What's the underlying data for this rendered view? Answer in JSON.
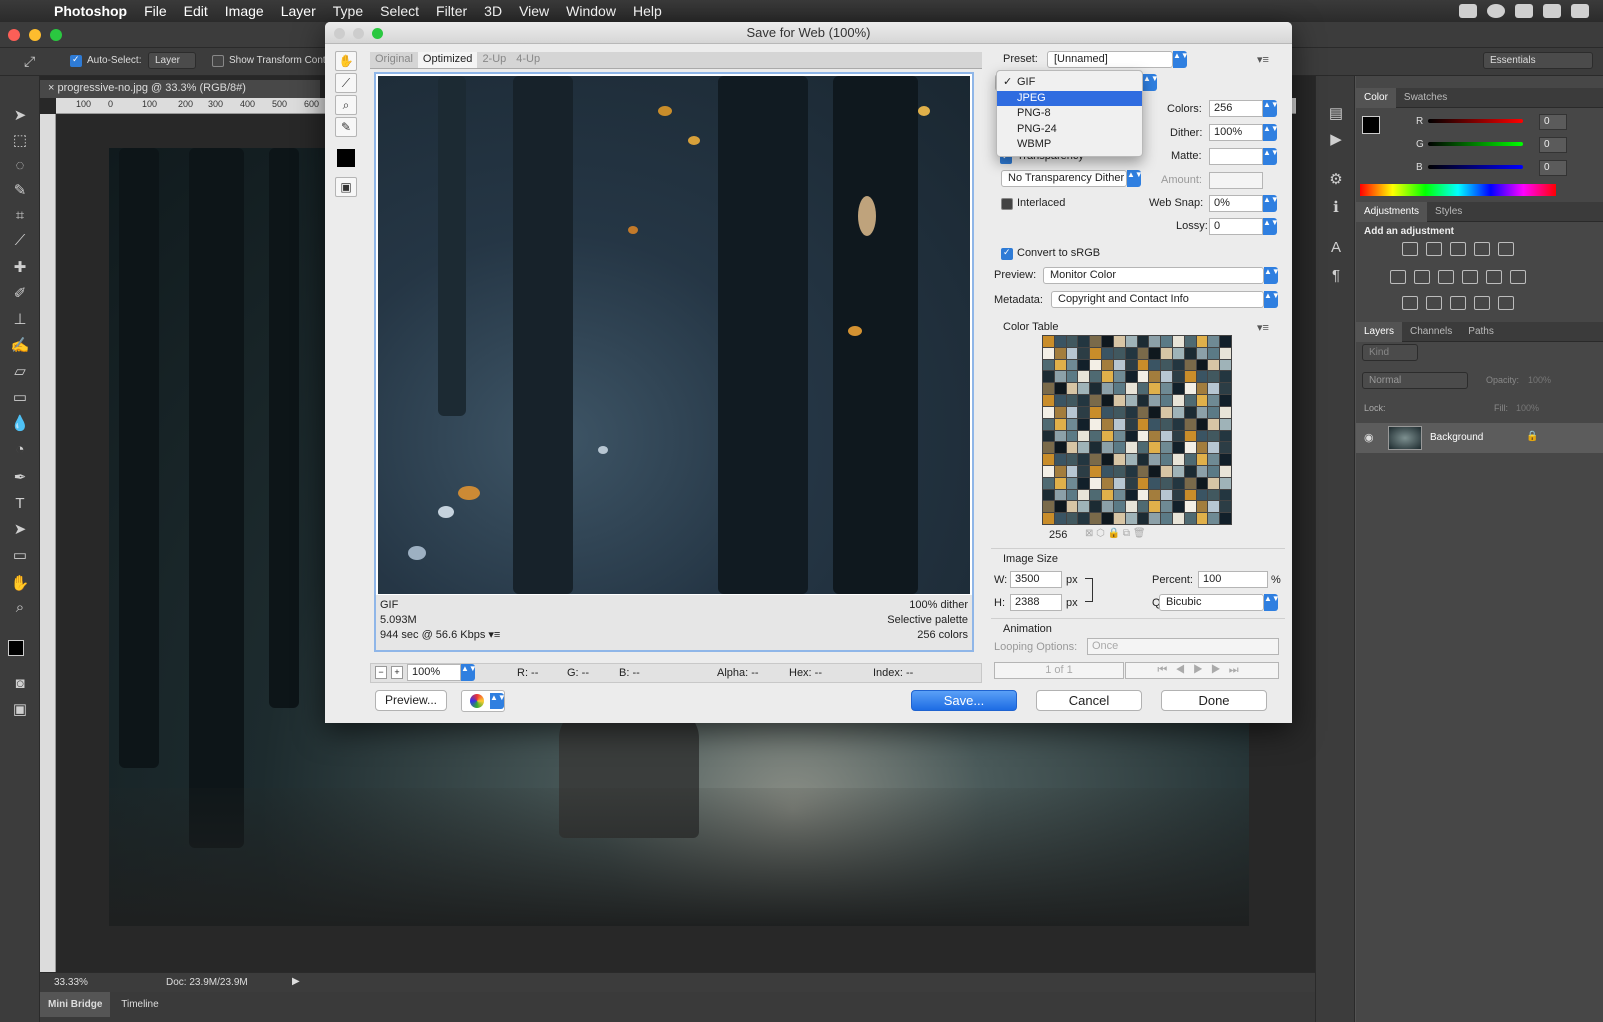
{
  "menubar": {
    "app": "Photoshop",
    "items": [
      "File",
      "Edit",
      "Image",
      "Layer",
      "Type",
      "Select",
      "Filter",
      "3D",
      "View",
      "Window",
      "Help"
    ]
  },
  "options": {
    "auto_select": "Auto-Select:",
    "auto_select_target": "Layer",
    "show_transform": "Show Transform Contro",
    "workspace": "Essentials"
  },
  "document": {
    "tab": "progressive-no.jpg @ 33.3% (RGB/8#)",
    "ruler_labels": [
      "100",
      "0",
      "100",
      "200",
      "300",
      "400",
      "500",
      "600"
    ],
    "zoom": "33.33%",
    "doc_size": "Doc: 23.9M/23.9M"
  },
  "bottom_tabs": [
    "Mini Bridge",
    "Timeline"
  ],
  "dialog": {
    "title": "Save for Web (100%)",
    "view_tabs": [
      "Original",
      "Optimized",
      "2-Up",
      "4-Up"
    ],
    "info": {
      "format": "GIF",
      "size": "5.093M",
      "time": "944 sec @ 56.6 Kbps",
      "dither": "100% dither",
      "palette": "Selective palette",
      "colors": "256 colors"
    },
    "preset_label": "Preset:",
    "preset_value": "[Unnamed]",
    "format_menu": {
      "items": [
        "GIF",
        "JPEG",
        "PNG-8",
        "PNG-24",
        "WBMP"
      ],
      "checked": "GIF",
      "highlighted": "JPEG"
    },
    "colors_label": "Colors:",
    "colors_value": "256",
    "dither_label": "Dither:",
    "dither_value": "100%",
    "transparency_label": "Transparency",
    "matte_label": "Matte:",
    "trans_dither_value": "No Transparency Dither",
    "amount_label": "Amount:",
    "interlaced_label": "Interlaced",
    "websnap_label": "Web Snap:",
    "websnap_value": "0%",
    "lossy_label": "Lossy:",
    "lossy_value": "0",
    "srgb_label": "Convert to sRGB",
    "preview_label": "Preview:",
    "preview_value": "Monitor Color",
    "metadata_label": "Metadata:",
    "metadata_value": "Copyright and Contact Info",
    "colortable_label": "Color Table",
    "colortable_count": "256",
    "imagesize_label": "Image Size",
    "w_label": "W:",
    "w_value": "3500",
    "h_label": "H:",
    "h_value": "2388",
    "px": "px",
    "percent_label": "Percent:",
    "percent_value": "100",
    "percent_sign": "%",
    "quality_label": "Quality:",
    "quality_value": "Bicubic",
    "animation_label": "Animation",
    "looping_label": "Looping Options:",
    "looping_value": "Once",
    "frame_counter": "1 of 1",
    "zoom_value": "100%",
    "readout": {
      "r": "R: --",
      "g": "G: --",
      "b": "B: --",
      "alpha": "Alpha: --",
      "hex": "Hex: --",
      "index": "Index: --"
    },
    "buttons": {
      "preview": "Preview...",
      "save": "Save...",
      "cancel": "Cancel",
      "done": "Done"
    }
  },
  "panels": {
    "color_tabs": [
      "Color",
      "Swatches"
    ],
    "rgb": [
      {
        "label": "R",
        "value": "0"
      },
      {
        "label": "G",
        "value": "0"
      },
      {
        "label": "B",
        "value": "0"
      }
    ],
    "adj_tabs": [
      "Adjustments",
      "Styles"
    ],
    "adj_title": "Add an adjustment",
    "layer_tabs": [
      "Layers",
      "Channels",
      "Paths"
    ],
    "kind": "Kind",
    "blend": "Normal",
    "opacity_label": "Opacity:",
    "opacity_value": "100%",
    "lock_label": "Lock:",
    "fill_label": "Fill:",
    "fill_value": "100%",
    "layer_name": "Background"
  },
  "colors": {
    "accent": "#2f6ce0",
    "dialog_bg": "#ececec",
    "panel_bg": "#474747"
  }
}
